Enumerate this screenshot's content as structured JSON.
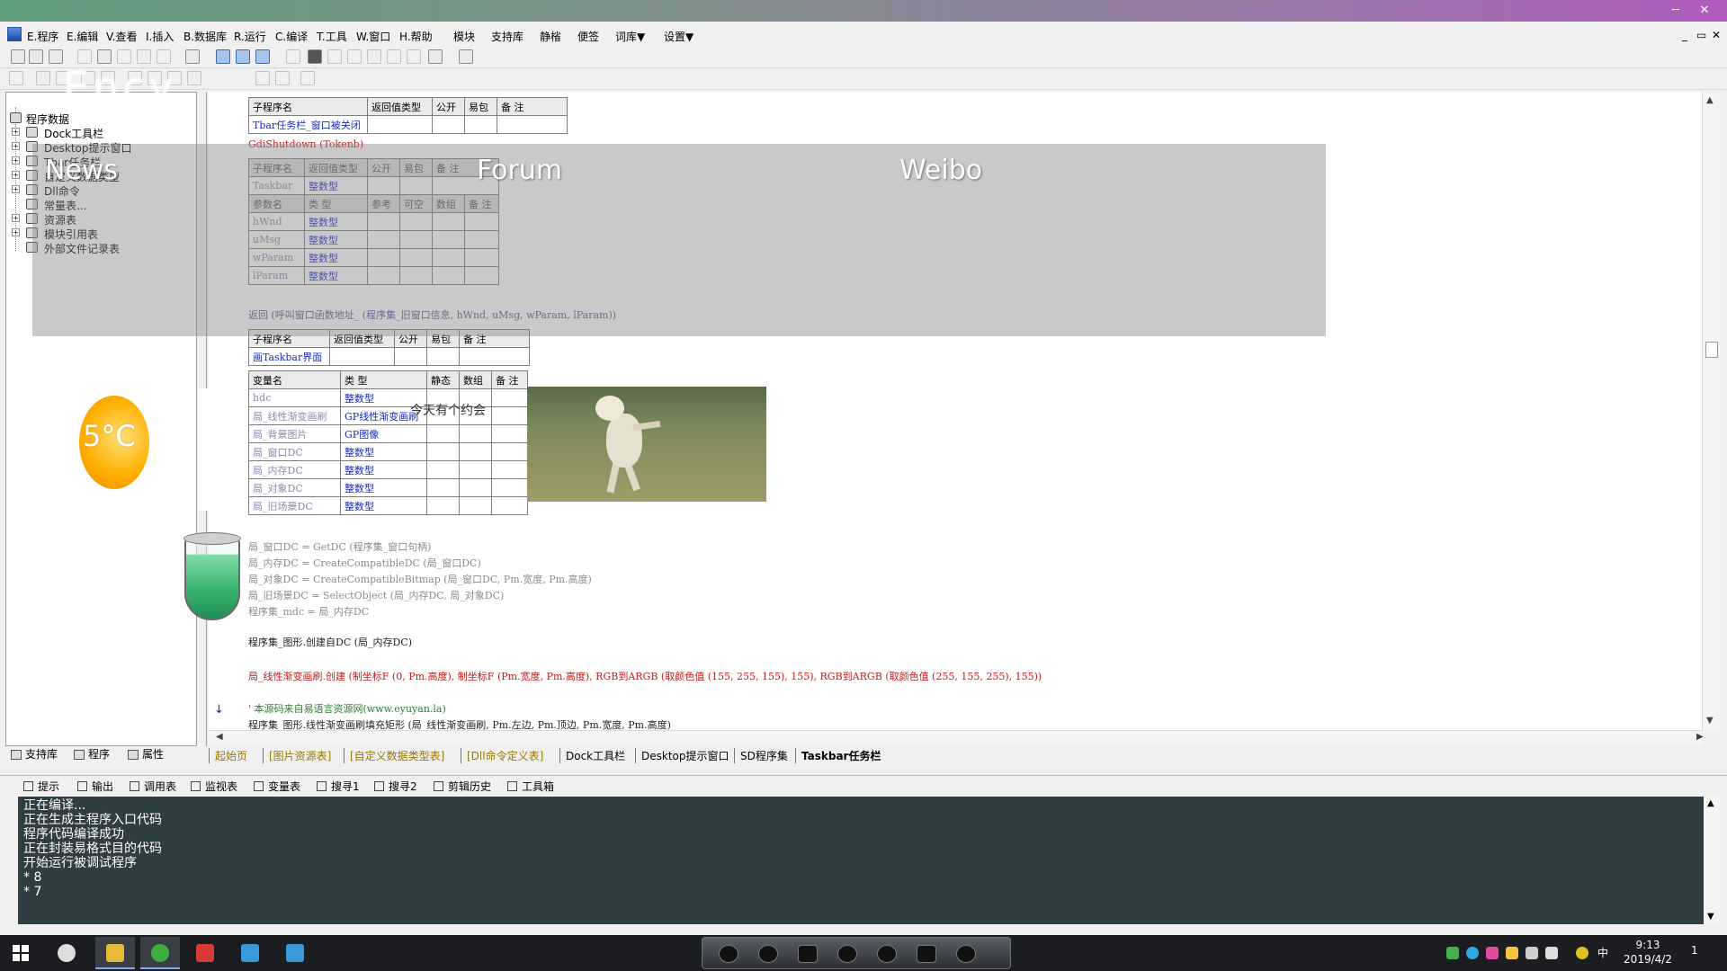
{
  "menu": {
    "items": [
      "E.程序",
      "E.编辑",
      "V.查看",
      "I.插入",
      "B.数据库",
      "R.运行",
      "C.编译",
      "T.工具",
      "W.窗口",
      "H.帮助",
      "模块",
      "支持库",
      "静㮐",
      "便签",
      "词库▼",
      "设置▼"
    ]
  },
  "window_controls": [
    "_",
    "▭",
    "✕"
  ],
  "tree": {
    "root": "程序数据",
    "items": [
      "Dock工具栏",
      "Desktop提示窗口",
      "Tbar任务栏",
      "自定义数据类型",
      "Dll命令",
      "常量表...",
      "资源表",
      "模块引用表",
      "外部文件记录表"
    ]
  },
  "code": {
    "t1_headers": [
      "子程序名",
      "返回值类型",
      "公开",
      "易包",
      "备 注"
    ],
    "t1_row": "Tbar任务栏_窗口被关闭",
    "line_shutdown": "GdiShutdown (Tokenb)",
    "t2_headers": [
      "子程序名",
      "返回值类型",
      "公开",
      "易包",
      "备 注"
    ],
    "t2_row": [
      "Taskbar",
      "整数型"
    ],
    "t2_param_headers": [
      "参数名",
      "类 型",
      "参考",
      "可空",
      "数组",
      "备 注"
    ],
    "t2_params": [
      [
        "hWnd",
        "整数型"
      ],
      [
        "uMsg",
        "整数型"
      ],
      [
        "wParam",
        "整数型"
      ],
      [
        "lParam",
        "整数型"
      ]
    ],
    "line_return": "返回 (呼叫窗口函数地址_ (程序集_旧窗口信息, hWnd, uMsg, wParam, lParam))",
    "t3_headers": [
      "子程序名",
      "返回值类型",
      "公开",
      "易包",
      "备 注"
    ],
    "t3_row": "画Taskbar界面",
    "t4_headers": [
      "变量名",
      "类 型",
      "静态",
      "数组",
      "备 注"
    ],
    "t4_rows": [
      [
        "hdc",
        "整数型"
      ],
      [
        "局_线性渐变画刷",
        "GP线性渐变画刷"
      ],
      [
        "局_背景图片",
        "GP图像"
      ],
      [
        "局_窗口DC",
        "整数型"
      ],
      [
        "局_内存DC",
        "整数型"
      ],
      [
        "局_对象DC",
        "整数型"
      ],
      [
        "局_旧场景DC",
        "整数型"
      ]
    ],
    "lines_faint": [
      "局_窗口DC = GetDC (程序集_窗口句柄)",
      "局_内存DC = CreateCompatibleDC (局_窗口DC)",
      "局_对象DC = CreateCompatibleBitmap (局_窗口DC, Pm.宽度, Pm.高度)",
      "局_旧场景DC = SelectObject (局_内存DC, 局_对象DC)",
      "程序集_mdc = 局_内存DC"
    ],
    "line_create": "程序集_图形.创建自DC (局_内存DC)",
    "line_brush": "局_线性渐变画刷.创建 (制坐标F (0, Pm.高度), 制坐标F (Pm.宽度, Pm.高度), RGB到ARGB (取颜色值 (155, 255, 155), 155), RGB到ARGB (取颜色值 (255, 155, 255), 155))",
    "line_comment": "' 本源码来自易语言资源网(www.eyuyan.la)",
    "line_fill": "程序集_图形.线性渐变画刷填充矩形 (局_线性渐变画刷, Pm.左边, Pm.顶边, Pm.宽度, Pm.高度)"
  },
  "overlay": {
    "labels": [
      "News",
      "Forum",
      "Weibo"
    ],
    "blur_text": "Ency"
  },
  "widgets": {
    "temperature": "5°C",
    "photo_caption": "今天有个约会"
  },
  "left_tabs": [
    "支持库",
    "程序",
    "属性"
  ],
  "file_tabs": [
    "起始页",
    "[图片资源表]",
    "[自定义数据类型表]",
    "[Dll命令定义表]",
    "Dock工具栏",
    "Desktop提示窗口",
    "SD程序集",
    "Taskbar任务栏"
  ],
  "output_tabs": [
    "提示",
    "输出",
    "调用表",
    "监视表",
    "变量表",
    "搜寻1",
    "搜寻2",
    "剪辑历史",
    "工具箱"
  ],
  "console_lines": [
    "正在编译...",
    "正在生成主程序入口代码",
    "程序代码编译成功",
    "正在封装易格式目的代码",
    "开始运行被调试程序",
    "* 8",
    "* 7"
  ],
  "taskbar": {
    "time": "9:13",
    "date": "2019/4/2",
    "ime": "中",
    "notification": "1"
  },
  "colors": {
    "console_bg": "#2f3e43",
    "taskbar_bg": "#1b1d21",
    "code_blue": "#1a2bbd",
    "code_red": "#c41a1a"
  }
}
